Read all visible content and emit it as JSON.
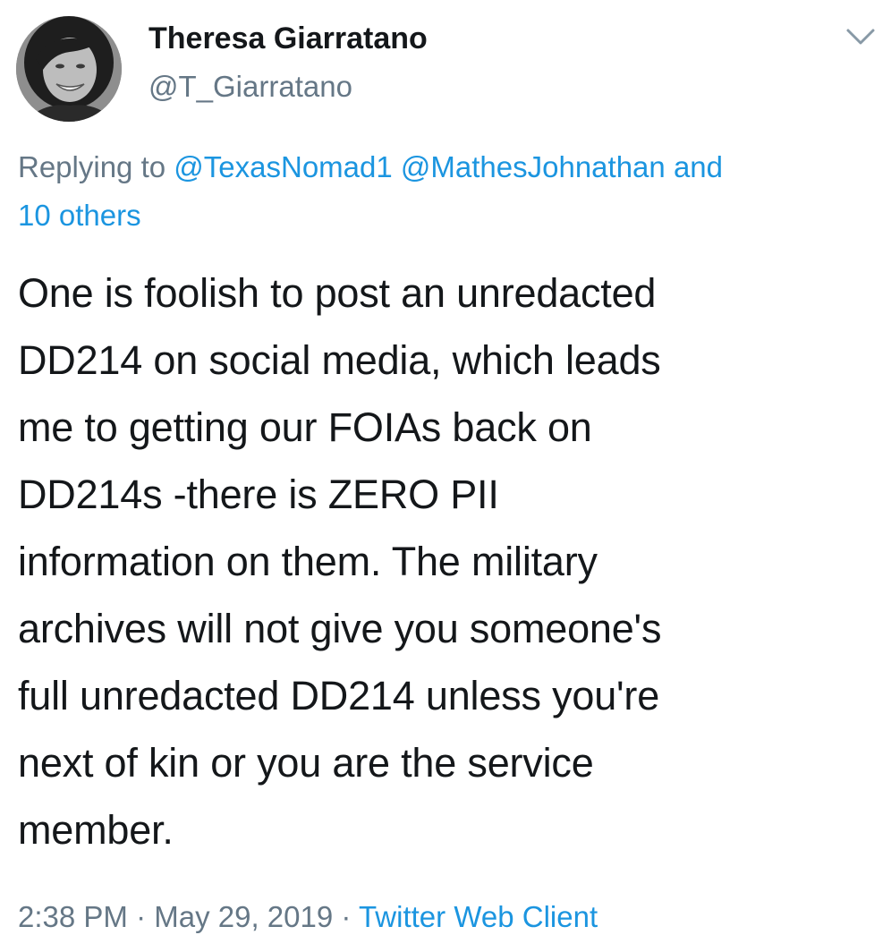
{
  "author": {
    "name": "Theresa Giarratano",
    "handle": "@T_Giarratano"
  },
  "reply": {
    "prefix": "Replying to",
    "mention1": "@TexasNomad1",
    "mention2": "@MathesJohnathan",
    "conjunction": "and",
    "others": "10 others"
  },
  "tweet": {
    "lines": [
      "One is foolish to post an unredacted",
      "DD214 on social media, which leads",
      "me to getting our FOIAs back on",
      "DD214s -there is ZERO PII",
      "information on them.  The military",
      "archives will not give you someone's",
      "full unredacted DD214 unless you're",
      "next of kin or you are the service",
      "member."
    ]
  },
  "meta": {
    "time": "2:38 PM",
    "separator": "·",
    "date": "May 29, 2019",
    "source": "Twitter Web Client"
  },
  "icons": {
    "avatar": "avatar-photo",
    "menu": "chevron-down-icon"
  },
  "colors": {
    "link": "#1b95e0",
    "secondary": "#657786",
    "text": "#14171a"
  }
}
